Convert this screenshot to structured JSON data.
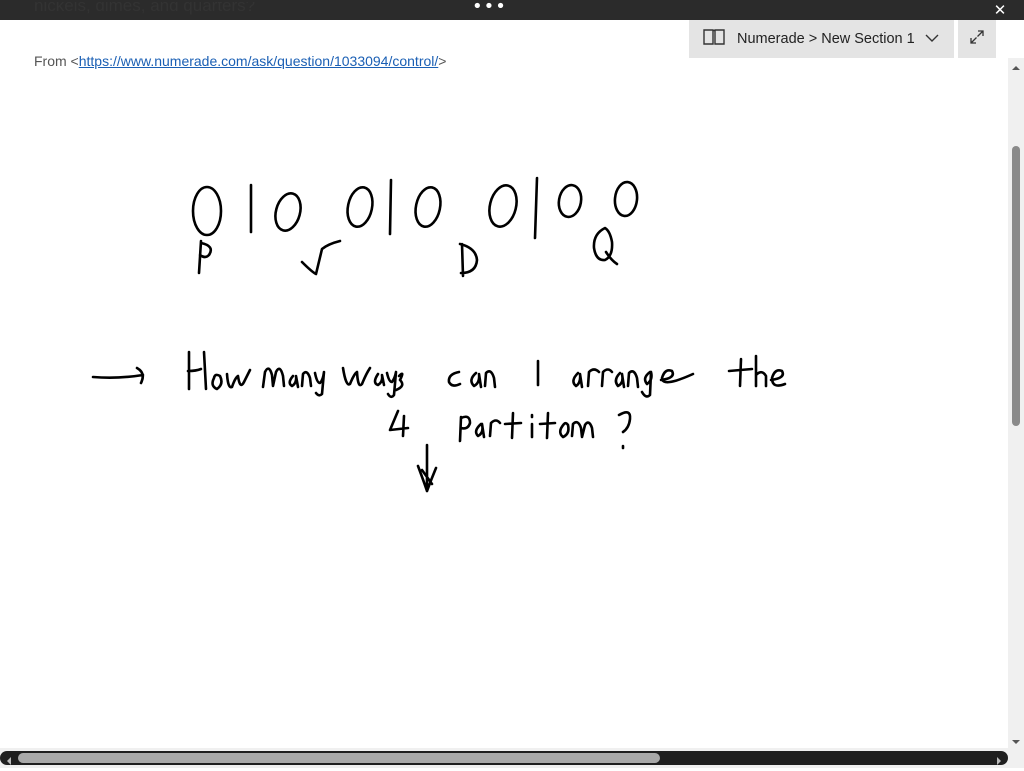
{
  "window": {
    "menu_dots": "•••",
    "close_symbol": "✕",
    "accent_bar": "#2b2b2b"
  },
  "note": {
    "previous_line_text": "nickels, dimes, and quarters?",
    "from_prefix": "From <",
    "from_link": "https://www.numerade.com/ask/question/1033094/control/",
    "from_suffix": ">"
  },
  "toolbar": {
    "notebook_label": "Numerade > New Section 1",
    "notebook_icon": "notebook-icon",
    "dropdown_icon": "chevron-down-icon",
    "expand_icon": "expand-icon"
  },
  "ink": {
    "stars_and_bars": "O|O O|O O|O O O",
    "coin_labels": [
      "P",
      "N",
      "D",
      "Q"
    ],
    "question_line_1": "→ How many ways can I arrange the",
    "question_line_2": "4 partitions?"
  }
}
